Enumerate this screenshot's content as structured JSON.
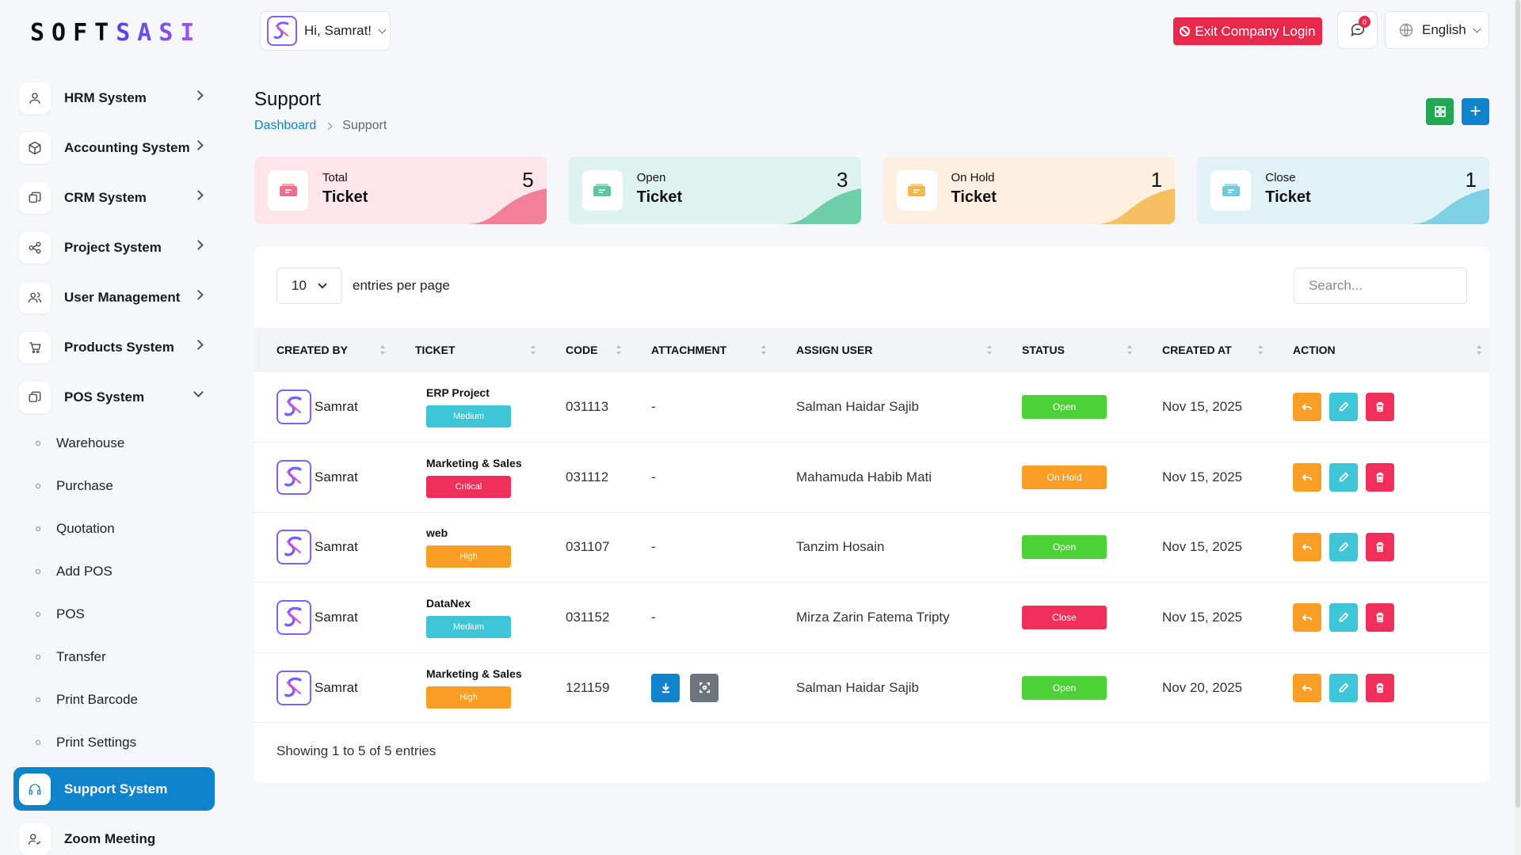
{
  "brand": {
    "left": "SOFT",
    "right": "SASI"
  },
  "sidebar": {
    "items": [
      {
        "label": "HRM System",
        "icon": "user-icon"
      },
      {
        "label": "Accounting System",
        "icon": "box-icon"
      },
      {
        "label": "CRM System",
        "icon": "layers-icon"
      },
      {
        "label": "Project System",
        "icon": "share-icon"
      },
      {
        "label": "User Management",
        "icon": "users-icon"
      },
      {
        "label": "Products System",
        "icon": "cart-icon"
      },
      {
        "label": "POS System",
        "icon": "layers-icon"
      }
    ],
    "pos_sub": [
      "Warehouse",
      "Purchase",
      "Quotation",
      "Add POS",
      "POS",
      "Transfer",
      "Print Barcode",
      "Print Settings"
    ],
    "active": {
      "label": "Support System",
      "icon": "headset-icon"
    },
    "after": {
      "label": "Zoom Meeting",
      "icon": "user-check-icon"
    }
  },
  "header": {
    "greeting": "Hi, Samrat!",
    "exit_label": "Exit Company Login",
    "notif_count": "0",
    "language": "English"
  },
  "page": {
    "title": "Support",
    "breadcrumb": {
      "home": "Dashboard",
      "current": "Support"
    }
  },
  "cards": [
    {
      "sub": "Total",
      "main": "Ticket",
      "value": "5",
      "color": "#fde6ea",
      "accent": "#f06d8a"
    },
    {
      "sub": "Open",
      "main": "Ticket",
      "value": "3",
      "color": "#dff3ee",
      "accent": "#5cc79e"
    },
    {
      "sub": "On Hold",
      "main": "Ticket",
      "value": "1",
      "color": "#fdf0e0",
      "accent": "#f5b64a"
    },
    {
      "sub": "Close",
      "main": "Ticket",
      "value": "1",
      "color": "#e0f2f6",
      "accent": "#6ccbe0"
    }
  ],
  "table": {
    "per_page": "10",
    "per_page_text": "entries per page",
    "search_placeholder": "Search...",
    "columns": [
      "CREATED BY",
      "TICKET",
      "CODE",
      "ATTACHMENT",
      "ASSIGN USER",
      "STATUS",
      "CREATED AT",
      "ACTION"
    ],
    "rows": [
      {
        "created_by": "Samrat",
        "ticket": "ERP Project",
        "priority": "Medium",
        "code": "031113",
        "attachment": "-",
        "assign": "Salman Haidar Sajib",
        "status": "Open",
        "created_at": "Nov 15, 2025"
      },
      {
        "created_by": "Samrat",
        "ticket": "Marketing & Sales",
        "priority": "Critical",
        "code": "031112",
        "attachment": "-",
        "assign": "Mahamuda Habib Mati",
        "status": "On Hold",
        "created_at": "Nov 15, 2025"
      },
      {
        "created_by": "Samrat",
        "ticket": "web",
        "priority": "High",
        "code": "031107",
        "attachment": "-",
        "assign": "Tanzim Hosain",
        "status": "Open",
        "created_at": "Nov 15, 2025"
      },
      {
        "created_by": "Samrat",
        "ticket": "DataNex",
        "priority": "Medium",
        "code": "031152",
        "attachment": "-",
        "assign": "Mirza Zarin Fatema Tripty",
        "status": "Close",
        "created_at": "Nov 15, 2025"
      },
      {
        "created_by": "Samrat",
        "ticket": "Marketing & Sales",
        "priority": "High",
        "code": "121159",
        "attachment": "",
        "assign": "Salman Haidar Sajib",
        "status": "Open",
        "created_at": "Nov 20, 2025"
      }
    ],
    "footer": "Showing 1 to 5 of 5 entries"
  },
  "colors": {
    "priority": {
      "Medium": "#3ec6d8",
      "Critical": "#f0305a",
      "High": "#fb9e25"
    },
    "status": {
      "Open": "#4cd137",
      "On Hold": "#fb9e25",
      "Close": "#f0305a"
    },
    "action_reply": "#fb9e25",
    "action_edit": "#3ec6d8",
    "action_delete": "#f0305a",
    "download": "#0f84cc",
    "preview": "#6c757d"
  }
}
